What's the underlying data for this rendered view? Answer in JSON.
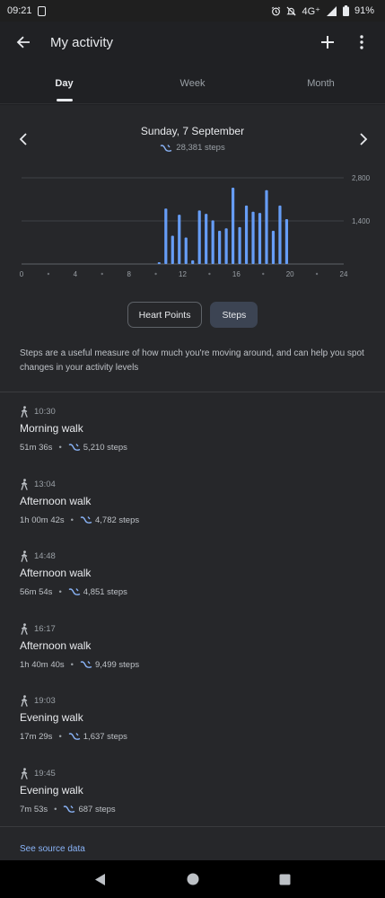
{
  "status": {
    "time": "09:21",
    "network": "4G⁺",
    "battery": "91%"
  },
  "app_bar": {
    "title": "My activity"
  },
  "tabs": [
    {
      "label": "Day"
    },
    {
      "label": "Week"
    },
    {
      "label": "Month"
    }
  ],
  "date": {
    "title": "Sunday, 7 September",
    "total_steps": "28,381 steps"
  },
  "chart_data": {
    "type": "bar",
    "x_ticks": [
      "0",
      "4",
      "8",
      "12",
      "16",
      "20",
      "24"
    ],
    "y_ticks": [
      "2,800",
      "1,400"
    ],
    "ylim": [
      0,
      2800
    ],
    "xlim": [
      0,
      24
    ],
    "bar_interval_minutes": 15,
    "bars": [
      {
        "t": 10.25,
        "v": 60
      },
      {
        "t": 10.75,
        "v": 1800
      },
      {
        "t": 11.25,
        "v": 920
      },
      {
        "t": 11.75,
        "v": 1600
      },
      {
        "t": 12.25,
        "v": 860
      },
      {
        "t": 12.75,
        "v": 120
      },
      {
        "t": 13.25,
        "v": 1740
      },
      {
        "t": 13.75,
        "v": 1630
      },
      {
        "t": 14.25,
        "v": 1420
      },
      {
        "t": 14.75,
        "v": 1080
      },
      {
        "t": 15.25,
        "v": 1160
      },
      {
        "t": 15.75,
        "v": 2480
      },
      {
        "t": 16.25,
        "v": 1200
      },
      {
        "t": 16.75,
        "v": 1900
      },
      {
        "t": 17.25,
        "v": 1700
      },
      {
        "t": 17.75,
        "v": 1660
      },
      {
        "t": 18.25,
        "v": 2400
      },
      {
        "t": 18.75,
        "v": 1080
      },
      {
        "t": 19.25,
        "v": 1900
      },
      {
        "t": 19.75,
        "v": 1460
      }
    ],
    "color": "#669df6"
  },
  "toggles": {
    "heart_points": "Heart Points",
    "steps": "Steps"
  },
  "description": "Steps are a useful measure of how much you're moving around, and can help you spot changes in your activity levels",
  "activities": [
    {
      "time": "10:30",
      "name": "Morning walk",
      "duration": "51m 36s",
      "steps": "5,210 steps"
    },
    {
      "time": "13:04",
      "name": "Afternoon walk",
      "duration": "1h 00m 42s",
      "steps": "4,782 steps"
    },
    {
      "time": "14:48",
      "name": "Afternoon walk",
      "duration": "56m 54s",
      "steps": "4,851 steps"
    },
    {
      "time": "16:17",
      "name": "Afternoon walk",
      "duration": "1h 40m 40s",
      "steps": "9,499 steps"
    },
    {
      "time": "19:03",
      "name": "Evening walk",
      "duration": "17m 29s",
      "steps": "1,637 steps"
    },
    {
      "time": "19:45",
      "name": "Evening walk",
      "duration": "7m 53s",
      "steps": "687 steps"
    }
  ],
  "source_link": "See source data",
  "icons": {
    "back": "arrow-back-icon",
    "add": "plus-icon",
    "more": "more-vert-icon",
    "prev": "chevron-left-icon",
    "next": "chevron-right-icon",
    "walk": "walking-icon",
    "steps": "footsteps-icon"
  },
  "colors": {
    "background": "#202124",
    "accent": "#8ab4f8",
    "bar": "#669df6"
  }
}
